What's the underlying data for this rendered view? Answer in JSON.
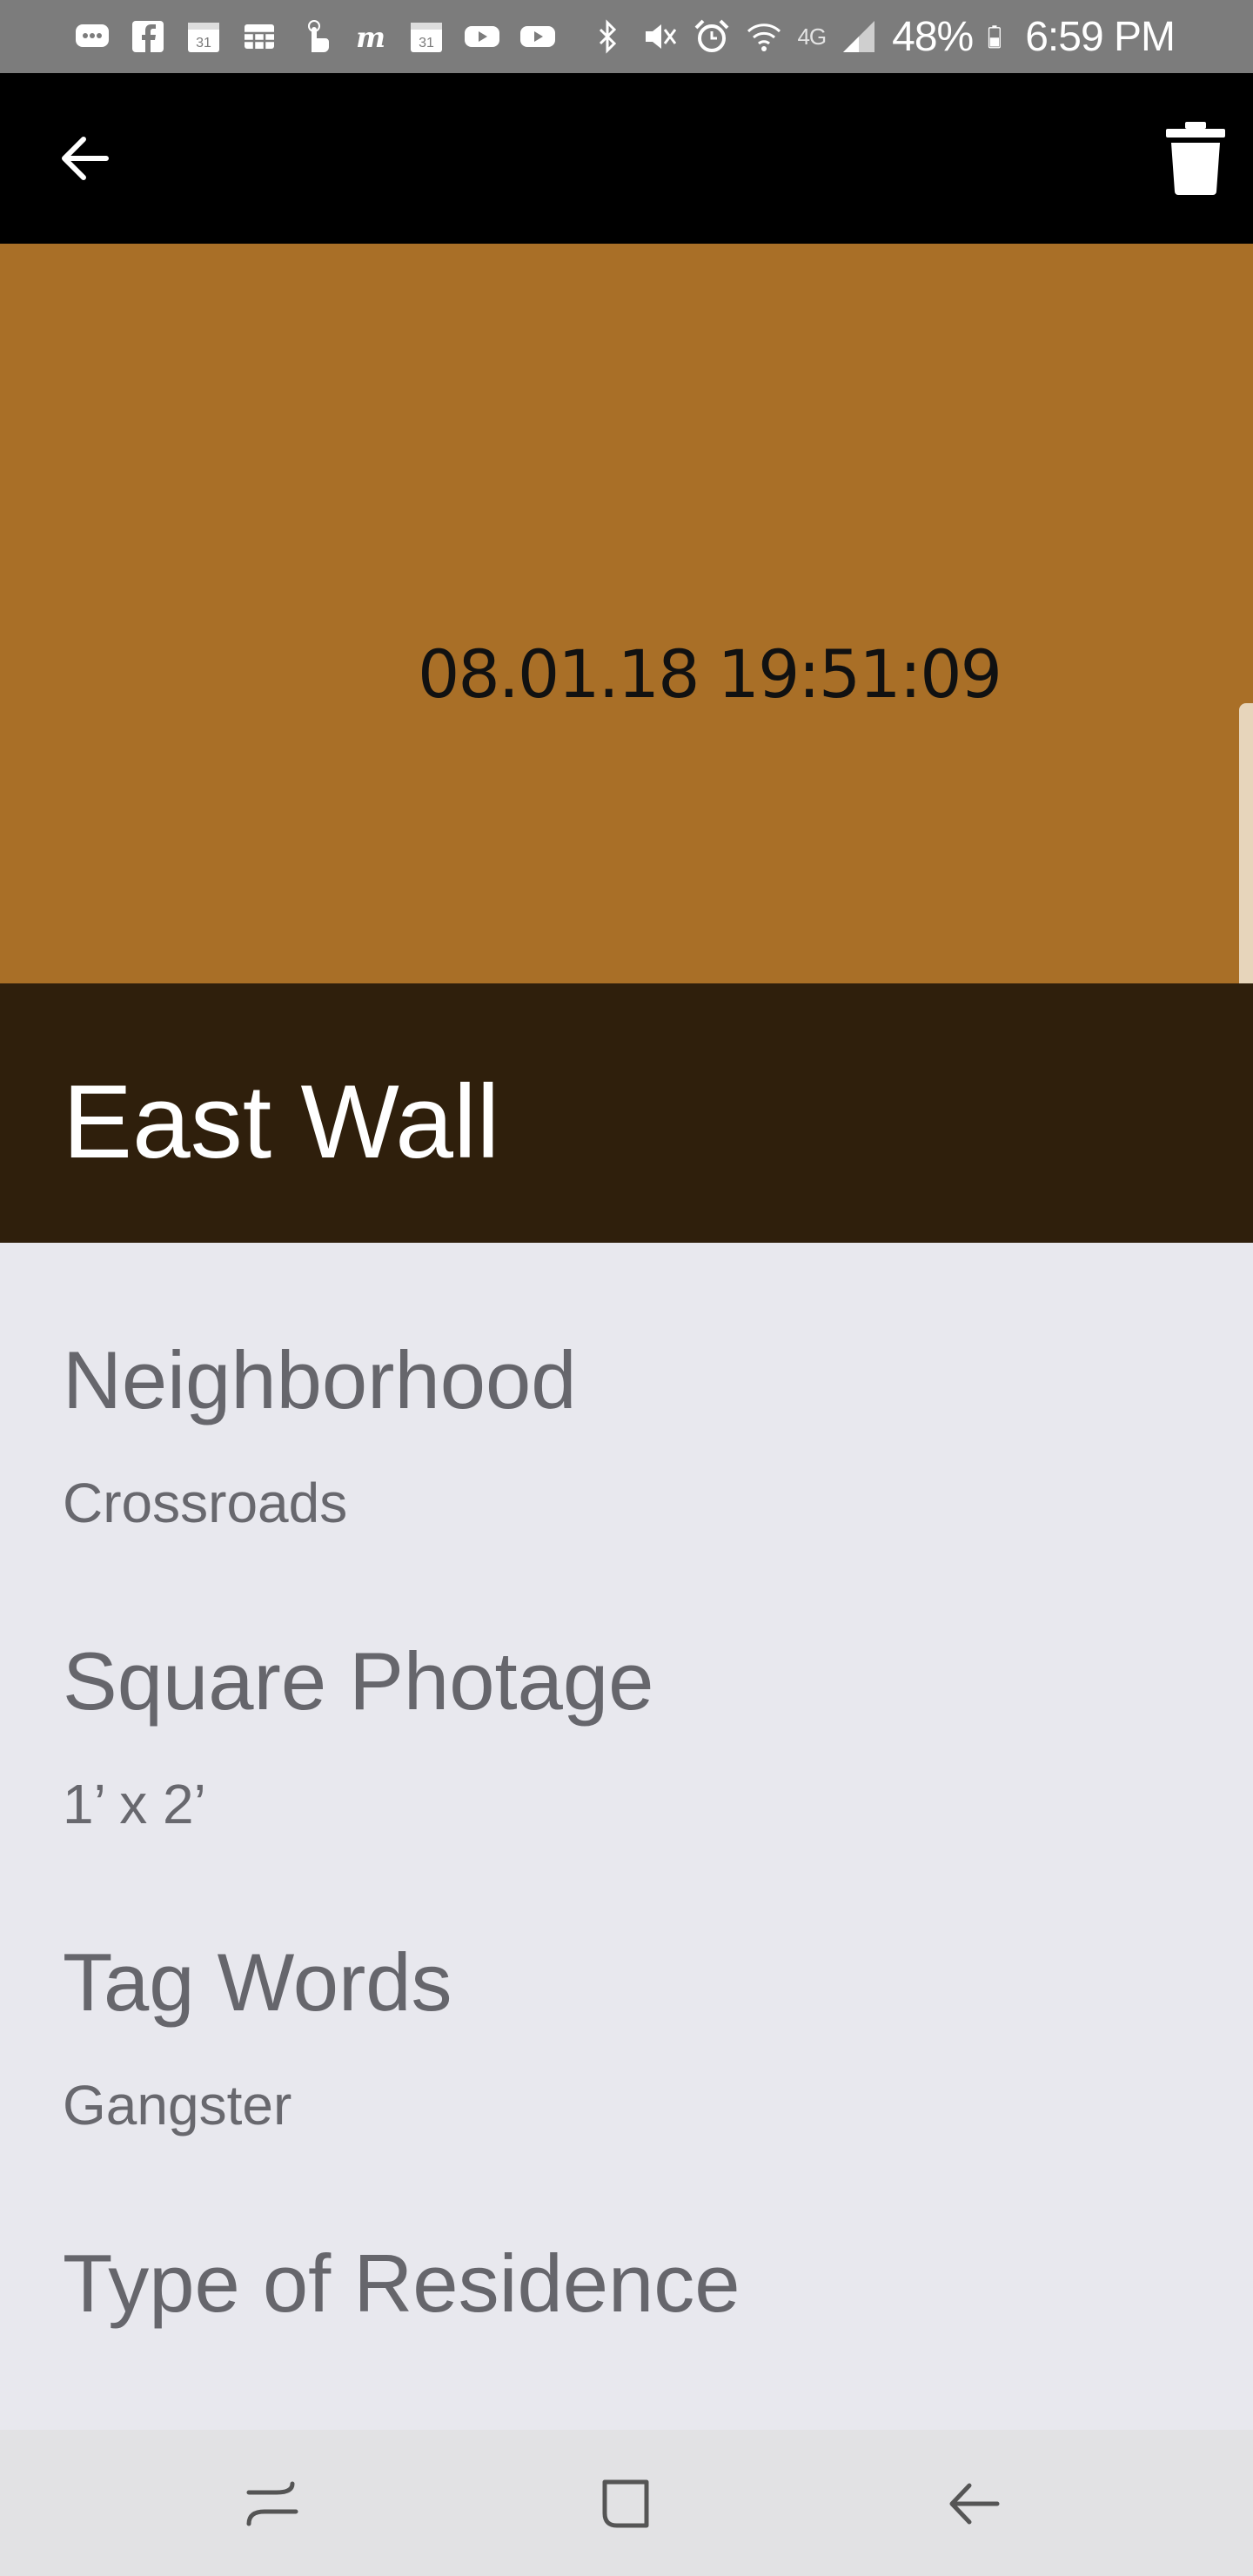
{
  "status_bar": {
    "battery_percent": "48%",
    "time": "6:59 PM",
    "network_label": "4G",
    "left_icons": [
      "messages-icon",
      "facebook-icon",
      "calendar-31-icon",
      "calculator-icon",
      "touch-icon",
      "m-app-icon",
      "calendar-31-icon",
      "youtube-icon",
      "youtube-icon"
    ],
    "right_icons": [
      "bluetooth-icon",
      "mute-icon",
      "alarm-icon",
      "wifi-icon",
      "signal-icon",
      "battery-icon"
    ]
  },
  "app_bar": {
    "back_icon": "back-arrow-icon",
    "delete_icon": "trash-icon"
  },
  "photo": {
    "timestamp": "08.01.18 19:51:09",
    "background_color": "#a96f27"
  },
  "entry": {
    "title": "East Wall"
  },
  "fields": [
    {
      "label": "Neighborhood",
      "value": "Crossroads"
    },
    {
      "label": "Square Photage",
      "value": "1’ x 2’"
    },
    {
      "label": "Tag Words",
      "value": "Gangster"
    },
    {
      "label": "Type of Residence",
      "value": ""
    }
  ],
  "nav_bar": {
    "recents_icon": "recents-icon",
    "home_icon": "home-icon",
    "back_icon": "back-icon"
  }
}
